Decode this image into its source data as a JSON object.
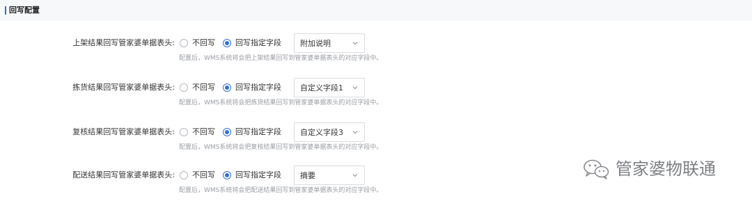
{
  "section": {
    "title": "回写配置"
  },
  "options": {
    "none_label": "不回写",
    "field_label": "回写指定字段"
  },
  "rows": [
    {
      "label": "上架结果回写管家婆单据表头:",
      "selected": "field",
      "select_value": "附加说明",
      "hint": "配置后，WMS系统将会把上架结果回写到管家婆单据表头的对应字段中。"
    },
    {
      "label": "拣货结果回写管家婆单据表头:",
      "selected": "field",
      "select_value": "自定义字段1",
      "hint": "配置后，WMS系统将会把拣货结果回写到管家婆单据表头的对应字段中。"
    },
    {
      "label": "复核结果回写管家婆单据表头:",
      "selected": "field",
      "select_value": "自定义字段3",
      "hint": "配置后，WMS系统将会把复核结果回写到管家婆单据表头的对应字段中。"
    },
    {
      "label": "配送结果回写管家婆单据表头:",
      "selected": "field",
      "select_value": "摘要",
      "hint": "配置后，WMS系统将会把配送结果回写到管家婆单据表头的对应字段中。"
    }
  ],
  "watermark": {
    "text": "管家婆物联通",
    "icon": "wechat-icon"
  },
  "colors": {
    "accent": "#2f6fd6",
    "header_bg": "#f7f8fa",
    "hint_text": "#9a9da3"
  }
}
